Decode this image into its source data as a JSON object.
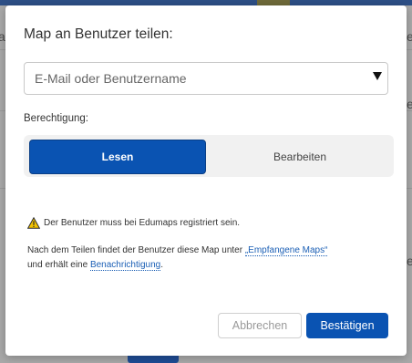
{
  "dialog": {
    "title": "Map an Benutzer teilen:",
    "user_select": {
      "placeholder": "E-Mail oder Benutzername"
    },
    "permission": {
      "label": "Berechtigung:",
      "options": [
        "Lesen",
        "Bearbeiten"
      ],
      "selected": "Lesen"
    },
    "warning": "Der Benutzer muss bei Edumaps registriert sein.",
    "info": {
      "text_before": "Nach dem Teilen findet der Benutzer diese Map unter ",
      "link_received": "„Empfangene Maps“",
      "text_middle": "und erhält eine ",
      "link_notification": "Benachrichtigung",
      "text_end": "."
    },
    "buttons": {
      "cancel": "Abbrechen",
      "confirm": "Bestätigen"
    }
  },
  "background": {
    "partial_texts": [
      "a",
      "e",
      "e",
      "e"
    ]
  },
  "colors": {
    "primary": "#0a53b2",
    "link": "#1b5fb5",
    "warning": "#f2c200"
  }
}
